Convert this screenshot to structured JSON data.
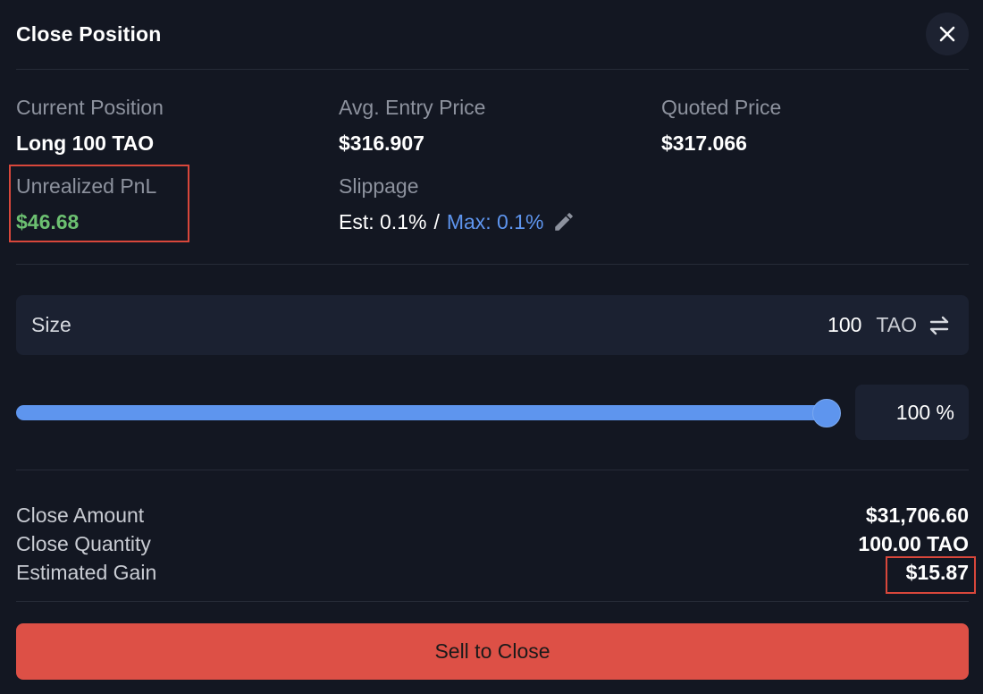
{
  "header": {
    "title": "Close Position",
    "close_icon": "close-icon"
  },
  "info": {
    "current_position": {
      "label": "Current Position",
      "value": "Long 100 TAO"
    },
    "avg_entry_price": {
      "label": "Avg. Entry Price",
      "value": "$316.907"
    },
    "quoted_price": {
      "label": "Quoted Price",
      "value": "$317.066"
    },
    "unrealized_pnl": {
      "label": "Unrealized PnL",
      "value": "$46.68"
    },
    "slippage": {
      "label": "Slippage",
      "est": "Est: 0.1%",
      "separator": "/",
      "max": "Max: 0.1%",
      "edit_icon": "pencil-icon"
    }
  },
  "size": {
    "label": "Size",
    "value": "100",
    "unit": "TAO",
    "swap_icon": "swap-arrows-icon"
  },
  "slider": {
    "percent_fraction": 1.0,
    "percent_label": "100 %"
  },
  "summary": {
    "close_amount": {
      "label": "Close Amount",
      "value": "$31,706.60"
    },
    "close_quantity": {
      "label": "Close Quantity",
      "value": "100.00 TAO"
    },
    "estimated_gain": {
      "label": "Estimated Gain",
      "value": "$15.87"
    }
  },
  "action": {
    "sell_label": "Sell to Close"
  },
  "colors": {
    "background": "#131722",
    "panel": "#1b2131",
    "accent_blue": "#5e95ee",
    "positive_green": "#6cc071",
    "sell_red": "#dd5046",
    "highlight_red": "#d8473b"
  }
}
